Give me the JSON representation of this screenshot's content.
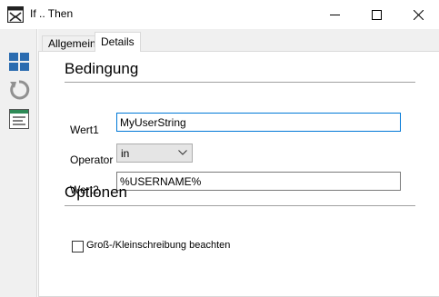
{
  "window": {
    "title": "If .. Then"
  },
  "tabs": [
    {
      "label": "Allgemein",
      "active": false
    },
    {
      "label": "Details",
      "active": true
    }
  ],
  "sections": {
    "condition_title": "Bedingung",
    "options_title": "Optionen"
  },
  "fields": {
    "wert1_label": "Wert1",
    "wert1_value": "MyUserString",
    "operator_label": "Operator",
    "operator_value": "in",
    "wert2_label": "Wert2",
    "wert2_value": "%USERNAME%"
  },
  "options": {
    "case_sensitive_label": "Groß-/Kleinschreibung beachten",
    "case_sensitive_checked": false
  },
  "toolbar": {
    "icons": [
      "layout-icon",
      "refresh-icon",
      "list-icon"
    ]
  },
  "colors": {
    "accent": "#0078d7",
    "toolbar_bg": "#f0f0f0",
    "layout_icon": "#2b6cb0"
  }
}
